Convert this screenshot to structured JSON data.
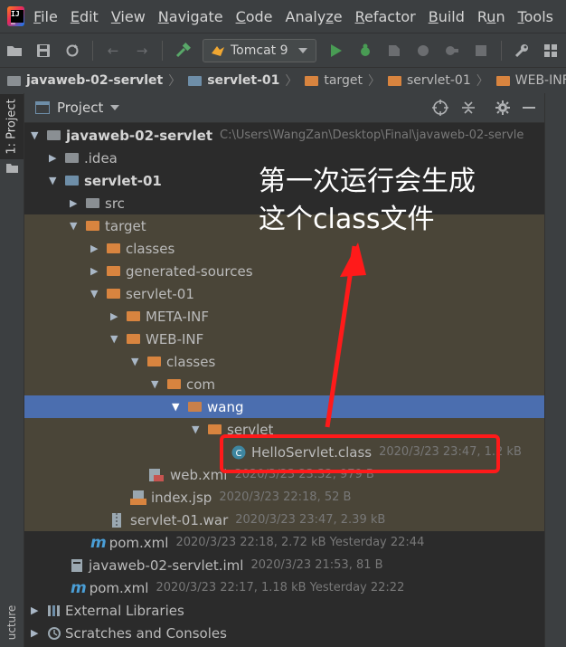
{
  "menubar": {
    "items": [
      "File",
      "Edit",
      "View",
      "Navigate",
      "Code",
      "Analyze",
      "Refactor",
      "Build",
      "Run",
      "Tools"
    ],
    "mnemonics": [
      "F",
      "E",
      "V",
      "N",
      "C",
      "z",
      "R",
      "B",
      "u",
      "T"
    ]
  },
  "toolbar": {
    "run_config": "Tomcat 9",
    "icons": [
      "open-folder-icon",
      "save-icon",
      "sync-icon",
      "back-icon",
      "forward-icon",
      "build-hammer-icon",
      "run-icon",
      "debug-icon",
      "coverage-icon",
      "profile-icon",
      "attach-icon",
      "stop-icon",
      "settings-wrench-icon",
      "structure-icon"
    ]
  },
  "breadcrumb": [
    "javaweb-02-servlet",
    "servlet-01",
    "target",
    "servlet-01",
    "WEB-INF"
  ],
  "side_tab": "1: Project",
  "side_bottom": "ucture",
  "panel": {
    "title": "Project"
  },
  "tree": {
    "root": {
      "label": "javaweb-02-servlet",
      "path": "C:\\Users\\WangZan\\Desktop\\Final\\javaweb-02-servle"
    },
    "idea": ".idea",
    "module": "servlet-01",
    "src": "src",
    "target": "target",
    "classes": "classes",
    "generated_sources": "generated-sources",
    "servlet01": "servlet-01",
    "meta_inf": "META-INF",
    "web_inf": "WEB-INF",
    "web_classes": "classes",
    "com": "com",
    "wang": "wang",
    "servlet": "servlet",
    "hello_class": {
      "label": "HelloServlet.class",
      "meta": "2020/3/23 23:47, 1.2 kB"
    },
    "web_xml": {
      "label": "web.xml",
      "meta": "2020/3/23 23:32, 979 B"
    },
    "index_jsp": {
      "label": "index.jsp",
      "meta": "2020/3/23 22:18, 52 B"
    },
    "war": {
      "label": "servlet-01.war",
      "meta": "2020/3/23 23:47, 2.39 kB"
    },
    "pom_module": {
      "label": "pom.xml",
      "meta": "2020/3/23 22:18, 2.72 kB Yesterday 22:44"
    },
    "iml": {
      "label": "javaweb-02-servlet.iml",
      "meta": "2020/3/23 21:53, 81 B"
    },
    "pom_root": {
      "label": "pom.xml",
      "meta": "2020/3/23 22:17, 1.18 kB Yesterday 22:22"
    },
    "ext_libs": "External Libraries",
    "scratches": "Scratches and Consoles"
  },
  "annotation": {
    "line1": "第一次运行会生成",
    "line2": "这个class文件",
    "color": "#ff1a1a"
  }
}
